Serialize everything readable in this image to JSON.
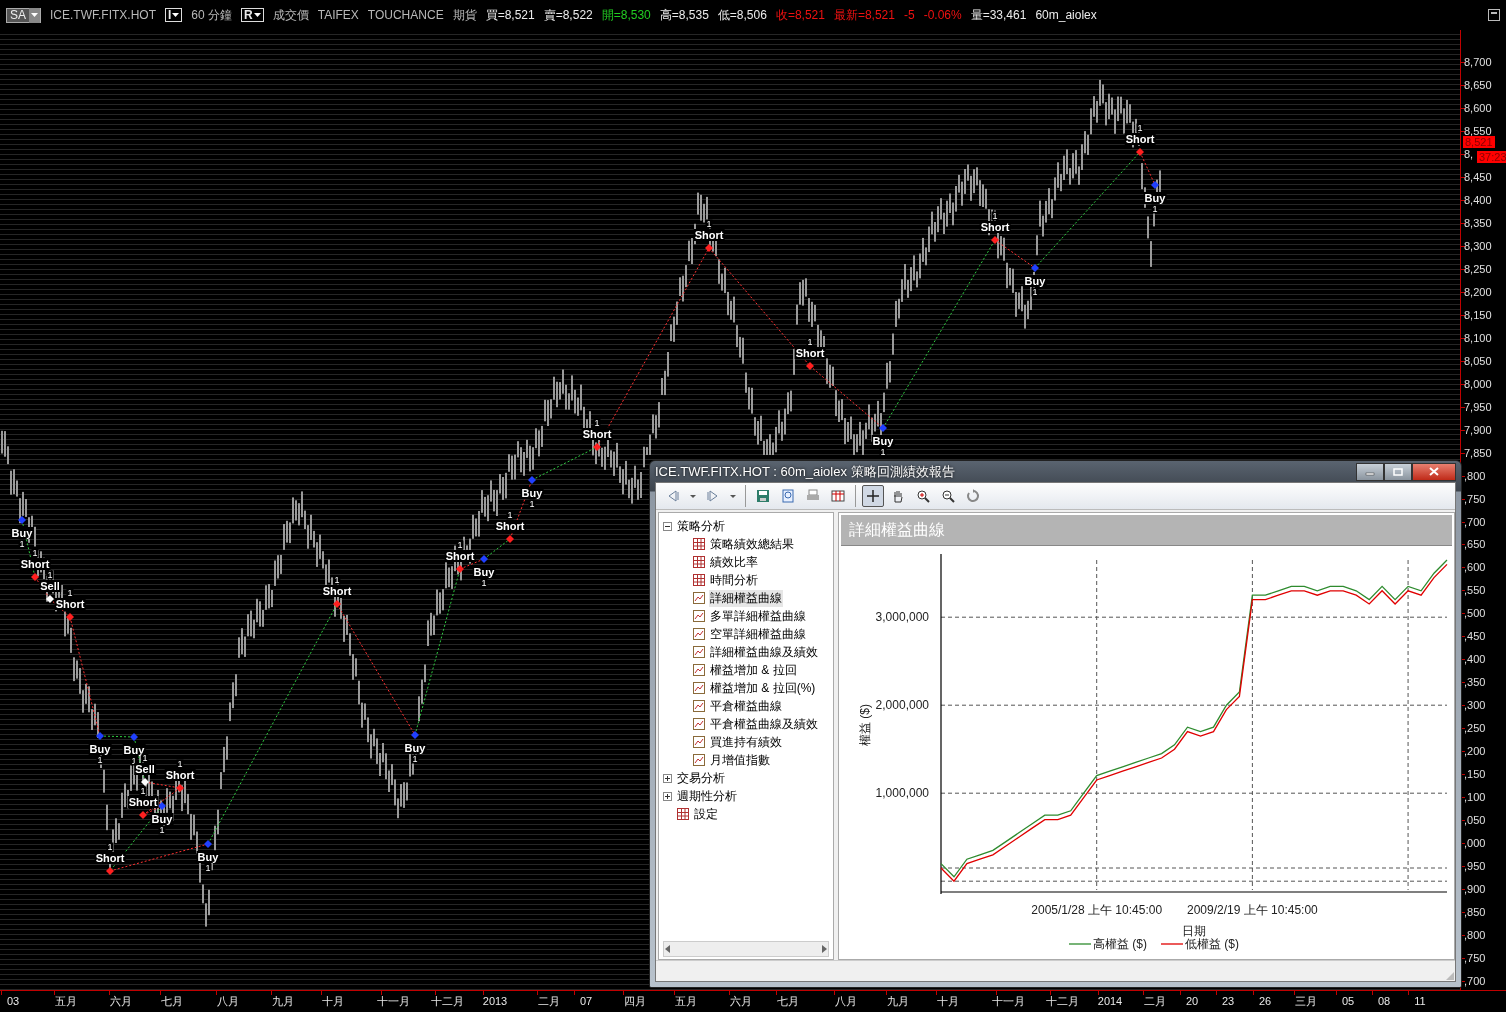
{
  "top_bar": {
    "items": [
      {
        "kind": "dropdown",
        "text": "SA"
      },
      {
        "kind": "text",
        "text": "ICE.TWF.FITX.HOT",
        "color": "#b8b8b8"
      },
      {
        "kind": "box",
        "text": "I",
        "color": "#e8e8e8"
      },
      {
        "kind": "text",
        "text": "60 分鐘",
        "color": "#b8b8b8"
      },
      {
        "kind": "box",
        "text": "R",
        "color": "#e8e8e8"
      },
      {
        "kind": "text",
        "text": "成交價",
        "color": "#b8b8b8"
      },
      {
        "kind": "text",
        "text": "TAIFEX",
        "color": "#b8b8b8"
      },
      {
        "kind": "text",
        "text": "TOUCHANCE",
        "color": "#b8b8b8"
      },
      {
        "kind": "text",
        "text": "期貨",
        "color": "#b8b8b8"
      },
      {
        "kind": "text",
        "text": "買=8,521",
        "color": "#ececec"
      },
      {
        "kind": "text",
        "text": "賣=8,522",
        "color": "#ececec"
      },
      {
        "kind": "text",
        "text": "開=8,530",
        "color": "#22cc22"
      },
      {
        "kind": "text",
        "text": "高=8,535",
        "color": "#ececec"
      },
      {
        "kind": "text",
        "text": "低=8,506",
        "color": "#ececec"
      },
      {
        "kind": "text",
        "text": "收=8,521",
        "color": "#ee1111"
      },
      {
        "kind": "text",
        "text": "最新=8,521",
        "color": "#ee1111"
      },
      {
        "kind": "text",
        "text": "-5",
        "color": "#ee1111"
      },
      {
        "kind": "text",
        "text": "-0.06%",
        "color": "#ee1111"
      },
      {
        "kind": "text",
        "text": "量=33,461",
        "color": "#ececec"
      },
      {
        "kind": "text",
        "text": "60m_aiolex",
        "color": "#ececec"
      }
    ]
  },
  "price_chart": {
    "signals": [
      {
        "label": "Buy",
        "kind": "buy",
        "count": "1"
      },
      {
        "label": "Short",
        "kind": "short",
        "count": "1"
      },
      {
        "label": "Sell",
        "kind": "sell",
        "count": "1"
      },
      {
        "label": "Short",
        "kind": "short",
        "count": "1"
      },
      {
        "label": "Buy",
        "kind": "buy",
        "count": "1"
      },
      {
        "label": "Buy",
        "kind": "buy",
        "count": "1"
      },
      {
        "label": "Sell",
        "kind": "sell",
        "count": "1"
      },
      {
        "label": "Short",
        "kind": "short",
        "count": "1"
      },
      {
        "label": "Short",
        "kind": "short",
        "count": "1"
      },
      {
        "label": "Buy",
        "kind": "buy",
        "count": "1"
      },
      {
        "label": "Short",
        "kind": "short",
        "count": "1"
      },
      {
        "label": "Buy",
        "kind": "buy",
        "count": "1"
      },
      {
        "label": "Short",
        "kind": "short",
        "count": "1"
      },
      {
        "label": "Buy",
        "kind": "buy",
        "count": "1"
      },
      {
        "label": "Short",
        "kind": "short",
        "count": "1"
      },
      {
        "label": "Buy",
        "kind": "buy",
        "count": "1"
      },
      {
        "label": "Short",
        "kind": "short",
        "count": "1"
      },
      {
        "label": "Buy",
        "kind": "buy",
        "count": "1"
      },
      {
        "label": "Short",
        "kind": "short",
        "count": "1"
      },
      {
        "label": "Short",
        "kind": "short",
        "count": "1"
      },
      {
        "label": "Short",
        "kind": "short",
        "count": "1"
      },
      {
        "label": "Buy",
        "kind": "buy",
        "count": "1"
      },
      {
        "label": "Short",
        "kind": "short",
        "count": "1"
      },
      {
        "label": "Buy",
        "kind": "buy",
        "count": "1"
      },
      {
        "label": "Short",
        "kind": "short",
        "count": "1"
      },
      {
        "label": "Buy",
        "kind": "buy",
        "count": "1"
      }
    ]
  },
  "price_axis": {
    "ticks": [
      "8,700",
      "8,650",
      "8,600",
      "8,550",
      "8,",
      "8,450",
      "8,400",
      "8,350",
      "8,300",
      "8,250",
      "8,200",
      "8,150",
      "8,100",
      "8,050",
      "8,000",
      "7,950",
      "7,900",
      "7,850",
      ",800",
      ",750",
      ",700",
      ",650",
      ",600",
      ",550",
      ",500",
      ",450",
      ",400",
      ",350",
      ",300",
      ",250",
      ",200",
      ",150",
      ",100",
      ",050",
      ",000",
      ",950",
      ",900",
      ",850",
      ",800",
      ",750",
      ",700"
    ],
    "last_price": "8,521",
    "countdown": "37:23"
  },
  "time_axis": {
    "labels": [
      "03",
      "五月",
      "六月",
      "七月",
      "八月",
      "九月",
      "十月",
      "十一月",
      "十二月",
      "2013",
      "二月",
      "07",
      "四月",
      "五月",
      "六月",
      "七月",
      "八月",
      "九月",
      "十月",
      "十一月",
      "十二月",
      "2014",
      "二月",
      "20",
      "23",
      "26",
      "三月",
      "05",
      "08",
      "11"
    ]
  },
  "report": {
    "title": "ICE.TWF.FITX.HOT : 60m_aiolex 策略回測績效報告",
    "tool_groups": [
      [
        {
          "kind": "back",
          "selected": false
        },
        {
          "kind": "dropdown",
          "selected": false
        },
        {
          "kind": "forward",
          "selected": false
        },
        {
          "kind": "dropdown",
          "selected": false
        }
      ],
      [
        {
          "kind": "save",
          "selected": false
        },
        {
          "kind": "preview",
          "selected": false
        },
        {
          "kind": "print",
          "selected": false
        },
        {
          "kind": "table",
          "selected": false
        }
      ],
      [
        {
          "kind": "crosshair",
          "selected": true
        },
        {
          "kind": "hand",
          "selected": false
        },
        {
          "kind": "zoom-in",
          "selected": false
        },
        {
          "kind": "zoom-out",
          "selected": false
        },
        {
          "kind": "reset",
          "selected": false
        }
      ]
    ],
    "tree": [
      {
        "label": "策略分析",
        "kind": "group",
        "expanded": true,
        "children": [
          {
            "label": "策略績效總結果",
            "kind": "table",
            "selected": false
          },
          {
            "label": "績效比率",
            "kind": "table",
            "selected": false
          },
          {
            "label": "時間分析",
            "kind": "table",
            "selected": false
          },
          {
            "label": "詳細權益曲線",
            "kind": "chart",
            "selected": true
          },
          {
            "label": "多單詳細權益曲線",
            "kind": "chart",
            "selected": false
          },
          {
            "label": "空單詳細權益曲線",
            "kind": "chart",
            "selected": false
          },
          {
            "label": "詳細權益曲線及績效",
            "kind": "chart",
            "selected": false
          },
          {
            "label": "權益增加 & 拉回",
            "kind": "chart",
            "selected": false
          },
          {
            "label": "權益增加 & 拉回(%)",
            "kind": "chart",
            "selected": false
          },
          {
            "label": "平倉權益曲線",
            "kind": "chart",
            "selected": false
          },
          {
            "label": "平倉權益曲線及績效",
            "kind": "chart",
            "selected": false
          },
          {
            "label": "買進持有績效",
            "kind": "chart",
            "selected": false
          },
          {
            "label": "月增值指數",
            "kind": "chart",
            "selected": false
          }
        ]
      },
      {
        "label": "交易分析",
        "kind": "group",
        "expanded": false
      },
      {
        "label": "週期性分析",
        "kind": "group",
        "expanded": false
      },
      {
        "label": "設定",
        "kind": "table",
        "selected": false
      }
    ],
    "panel_title": "詳細權益曲線",
    "chart_data": {
      "type": "line",
      "xlabel": "日期",
      "ylabel": "權益 ($)",
      "ylim": [
        -100000,
        3650000
      ],
      "categories": [
        null,
        null,
        null,
        null,
        null,
        null,
        null,
        null,
        null,
        null,
        null,
        null,
        "2005/1/28 上午 10:45:00",
        null,
        null,
        null,
        null,
        null,
        null,
        null,
        null,
        null,
        null,
        null,
        "2009/2/19 上午 10:45:00",
        null,
        null,
        null,
        null,
        null,
        null,
        null,
        null,
        null,
        null,
        null,
        null,
        null,
        null,
        null
      ],
      "yticks": [
        {
          "value": 1000000,
          "label": "1,000,000"
        },
        {
          "value": 2000000,
          "label": "2,000,000"
        },
        {
          "value": 3000000,
          "label": "3,000,000"
        }
      ],
      "series": [
        {
          "name": "高權益 ($)",
          "color": "#2e8b2e",
          "values": [
            200000,
            50000,
            250000,
            300000,
            350000,
            450000,
            550000,
            650000,
            750000,
            750000,
            800000,
            1000000,
            1200000,
            1250000,
            1300000,
            1350000,
            1400000,
            1450000,
            1550000,
            1750000,
            1700000,
            1750000,
            2000000,
            2150000,
            3250000,
            3250000,
            3300000,
            3350000,
            3350000,
            3300000,
            3350000,
            3350000,
            3300000,
            3200000,
            3350000,
            3200000,
            3350000,
            3300000,
            3500000,
            3650000
          ]
        },
        {
          "name": "低權益 ($)",
          "color": "#e00000",
          "values": [
            150000,
            0,
            200000,
            250000,
            300000,
            400000,
            500000,
            600000,
            700000,
            700000,
            750000,
            950000,
            1150000,
            1200000,
            1250000,
            1300000,
            1350000,
            1400000,
            1500000,
            1700000,
            1650000,
            1700000,
            1950000,
            2100000,
            3200000,
            3200000,
            3250000,
            3300000,
            3300000,
            3250000,
            3300000,
            3300000,
            3250000,
            3150000,
            3300000,
            3150000,
            3300000,
            3250000,
            3450000,
            3600000
          ]
        }
      ],
      "grid": true,
      "legend": true
    }
  }
}
